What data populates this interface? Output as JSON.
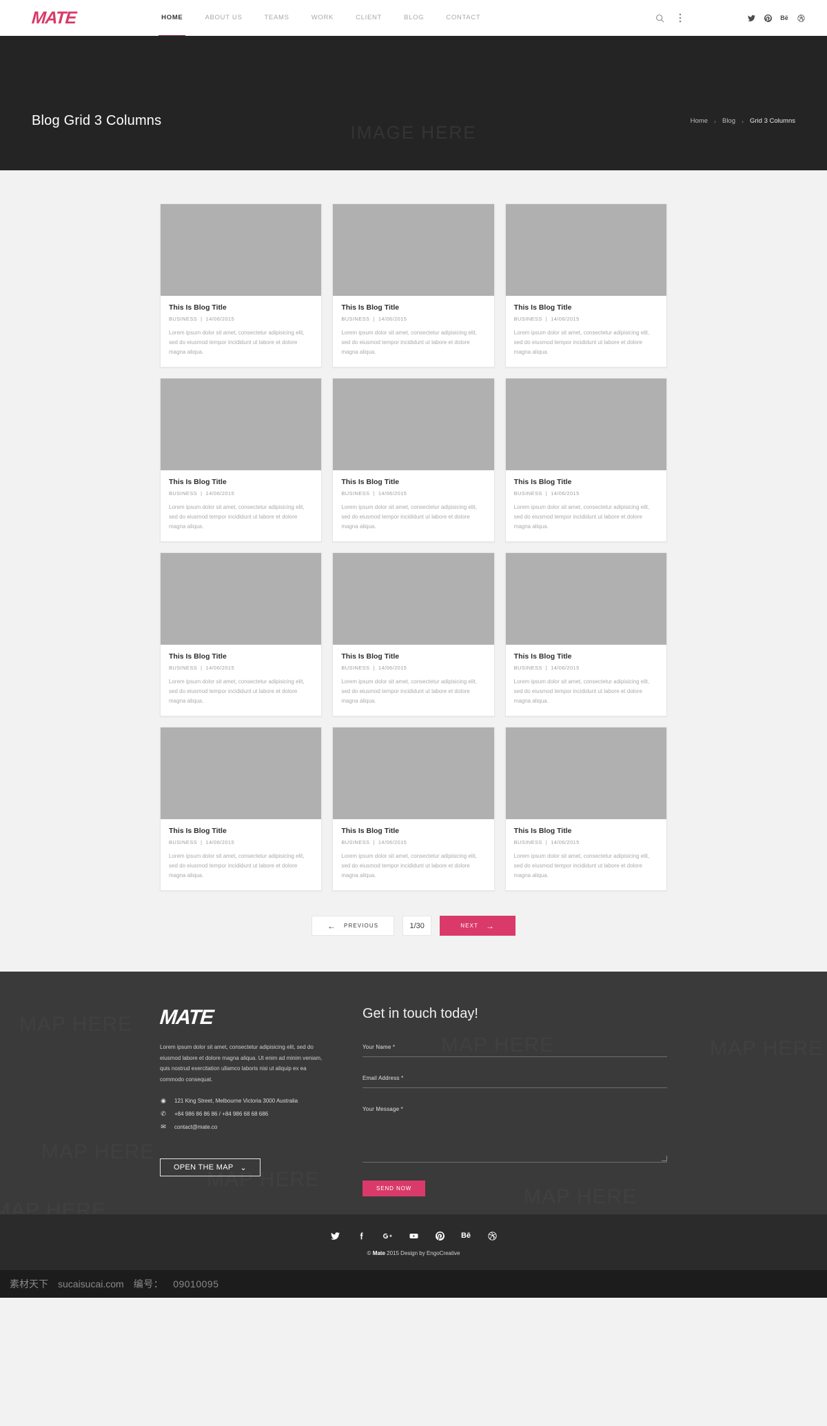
{
  "brand": {
    "name": "MATE",
    "accent": "#d93a6a"
  },
  "header": {
    "nav": [
      {
        "label": "HOME",
        "active": true
      },
      {
        "label": "ABOUT US",
        "active": false
      },
      {
        "label": "TEAMS",
        "active": false
      },
      {
        "label": "WORK",
        "active": false
      },
      {
        "label": "CLIENT",
        "active": false
      },
      {
        "label": "BLOG",
        "active": false
      },
      {
        "label": "CONTACT",
        "active": false
      }
    ],
    "tools": [
      {
        "icon": "search-icon",
        "glyph": "⚲"
      },
      {
        "icon": "more-vertical-icon",
        "glyph": "⋮"
      }
    ],
    "social": [
      {
        "icon": "twitter-icon",
        "glyph": "🐦"
      },
      {
        "icon": "pinterest-icon",
        "glyph": "P"
      },
      {
        "icon": "behance-icon",
        "glyph": "Bē"
      },
      {
        "icon": "dribbble-icon",
        "glyph": "◉"
      }
    ]
  },
  "hero": {
    "watermark": "IMAGE HERE",
    "title": "Blog Grid 3 Columns",
    "breadcrumb": [
      {
        "label": "Home",
        "current": false
      },
      {
        "label": "Blog",
        "current": false
      },
      {
        "label": "Grid 3 Columns",
        "current": true
      }
    ],
    "separator": "›"
  },
  "blog": {
    "card": {
      "title": "This Is Blog Title",
      "category": "BUSINESS",
      "date": "14/06/2015",
      "meta_separator": "|",
      "excerpt": "Lorem ipsum dolor sit amet, consectetur adipisicing elit, sed do eiusmod tempor incididunt ut labore et dolore magna aliqua."
    },
    "count": 12
  },
  "pagination": {
    "previous_label": "PREVIOUS",
    "previous_arrow": "←",
    "counter": "1/30",
    "next_label": "NEXT",
    "next_arrow": "→"
  },
  "footer": {
    "watermark": "MAP HERE",
    "logo": "MATE",
    "description": "Lorem ipsum dolor sit amet, consectetur adipisicing elit, sed do eiusmod labore et dolore magna aliqua. Ut enim ad minim veniam, quis nostrud exercitation ullamco laboris nisi ut aliquip ex ea commodo consequat.",
    "contact": [
      {
        "icon": "location-pin-icon",
        "glyph": "◉",
        "text": "121 King Street, Melbourne Victoria 3000 Australia"
      },
      {
        "icon": "phone-icon",
        "glyph": "✆",
        "text": "+84 986 86 86 86 / +84 986 68 68 686"
      },
      {
        "icon": "envelope-icon",
        "glyph": "✉",
        "text": "contact@mate.co"
      }
    ],
    "map_button": {
      "label": "OPEN THE MAP",
      "chevron": "⌄"
    },
    "form": {
      "title": "Get in touch today!",
      "fields": [
        {
          "label": "Your Name *",
          "value": "",
          "type": "text"
        },
        {
          "label": "Email Address *",
          "value": "",
          "type": "text"
        },
        {
          "label": "Your Message *",
          "value": "",
          "type": "textarea"
        }
      ],
      "submit_label": "SEND NOW"
    }
  },
  "bottombar": {
    "social": [
      {
        "icon": "twitter-icon",
        "glyph": "🐦"
      },
      {
        "icon": "facebook-icon",
        "glyph": "f"
      },
      {
        "icon": "google-plus-icon",
        "glyph": "g+"
      },
      {
        "icon": "youtube-icon",
        "glyph": "▶"
      },
      {
        "icon": "pinterest-icon",
        "glyph": "P"
      },
      {
        "icon": "behance-icon",
        "glyph": "Bē"
      },
      {
        "icon": "dribbble-icon",
        "glyph": "◉"
      }
    ],
    "copyright_symbol": "©",
    "copyright_brand": "Mate",
    "copyright_rest": "2015 Design by EngoCreative"
  },
  "watermark_strip": {
    "site_cn": "素材天下",
    "site_url": "sucaisucai.com",
    "code_label": "编号：",
    "code_value": "09010095"
  }
}
